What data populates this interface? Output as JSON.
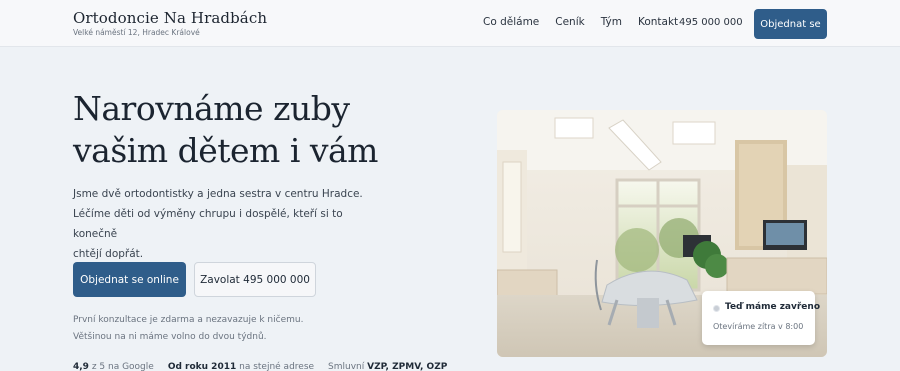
{
  "header": {
    "brand_name": "Ortodoncie Na Hradbách",
    "brand_address": "Velké náměstí 12, Hradec Králové",
    "nav": [
      {
        "label": "Co děláme"
      },
      {
        "label": "Ceník"
      },
      {
        "label": "Tým"
      },
      {
        "label": "Kontakt"
      }
    ],
    "phone": "495 000 000",
    "cta_label": "Objednat se"
  },
  "hero": {
    "title_line1": "Narovnáme zuby",
    "title_line2": "vašim dětem i vám",
    "lead_line1": "Jsme dvě ortodontistky a jedna sestra v centru Hradce.",
    "lead_line2": "Léčíme děti od výměny chrupu i dospělé, kteří si to konečně",
    "lead_line3": "chtějí dopřát.",
    "primary_button": "Objednat se online",
    "secondary_button": "Zavolat 495 000 000",
    "note_line1": "První konzultace je zdarma a nezavazuje k ničemu.",
    "note_line2": "Většinou na ni máme volno do dvou týdnů.",
    "facts": [
      {
        "strong": "4,9",
        "text": " z 5 na Google"
      },
      {
        "strong": "Od roku 2011",
        "text": " na stejné adrese"
      },
      {
        "text": "Smluvní ",
        "strong": "VZP, ZPMV, OZP"
      }
    ]
  },
  "status_card": {
    "title": "Teď máme zavřeno",
    "subtitle": "Otevíráme zítra v 8:00",
    "dot_color": "#c9ced6"
  },
  "colors": {
    "accent": "#2f5d8a",
    "background": "#eef2f6"
  }
}
